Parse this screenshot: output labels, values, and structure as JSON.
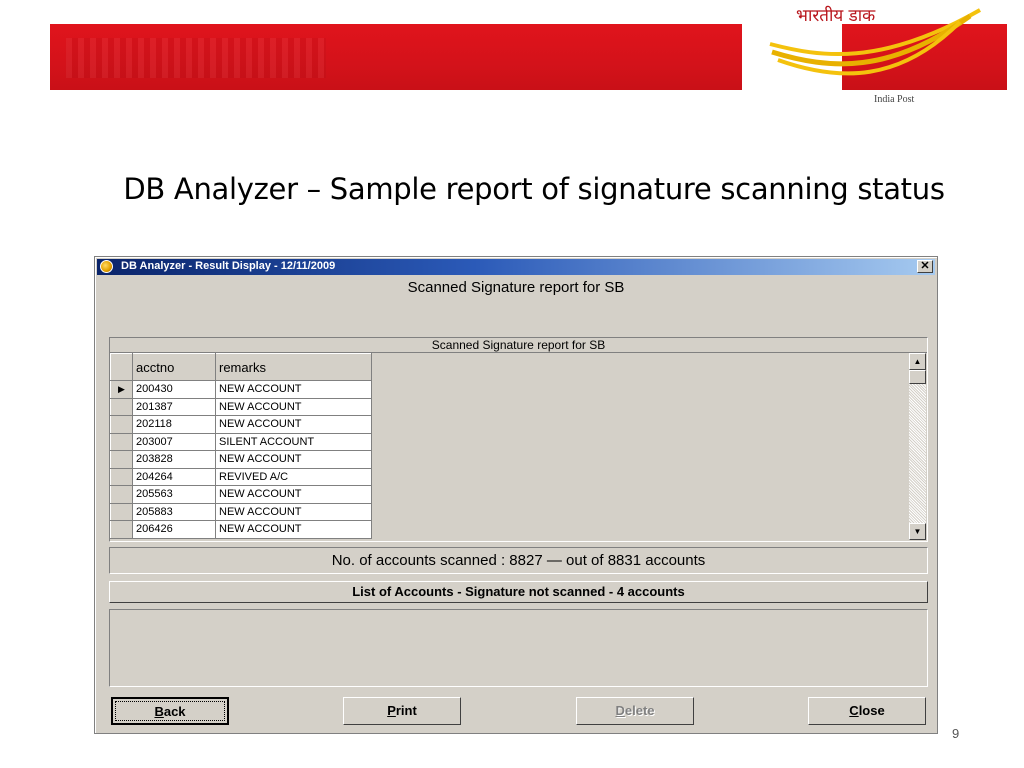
{
  "slide": {
    "logo_hindi": "भारतीय डाक",
    "logo_english": "India Post",
    "title": "DB Analyzer – Sample report of signature scanning status",
    "page_number": "9",
    "banner_color": "#d4121a"
  },
  "window": {
    "title": "DB Analyzer - Result Display - 12/11/2009",
    "close_glyph": "✕",
    "report_heading": "Scanned Signature report for SB",
    "titlebar_color": "#0a246a"
  },
  "grid": {
    "caption": "Scanned Signature report for SB",
    "columns": [
      "acctno",
      "remarks"
    ],
    "current_row_indicator": "▶",
    "rows": [
      {
        "acctno": "200430",
        "remarks": "NEW ACCOUNT"
      },
      {
        "acctno": "201387",
        "remarks": "NEW ACCOUNT"
      },
      {
        "acctno": "202118",
        "remarks": "NEW ACCOUNT"
      },
      {
        "acctno": "203007",
        "remarks": "SILENT ACCOUNT"
      },
      {
        "acctno": "203828",
        "remarks": "NEW ACCOUNT"
      },
      {
        "acctno": "204264",
        "remarks": "REVIVED A/C"
      },
      {
        "acctno": "205563",
        "remarks": "NEW ACCOUNT"
      },
      {
        "acctno": "205883",
        "remarks": "NEW ACCOUNT"
      },
      {
        "acctno": "206426",
        "remarks": "NEW ACCOUNT"
      }
    ],
    "scroll_up": "▲",
    "scroll_down": "▼"
  },
  "summary": {
    "count_text": "No. of accounts scanned : 8827 —  out of 8831 accounts",
    "list_title": "List of Accounts - Signature not scanned  -  4 accounts"
  },
  "buttons": {
    "back": {
      "mnemonic": "B",
      "rest": "ack"
    },
    "print": {
      "mnemonic": "P",
      "rest": "rint"
    },
    "delete": {
      "mnemonic": "D",
      "rest": "elete"
    },
    "close": {
      "mnemonic": "C",
      "rest": "lose"
    }
  }
}
